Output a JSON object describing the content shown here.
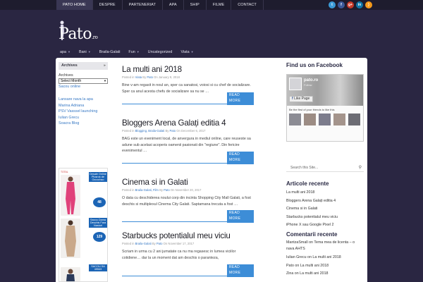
{
  "topnav": [
    "PATO HOME",
    "DESPRE",
    "PARTENERIAT",
    "APA",
    "SHIP",
    "FILME",
    "CONTACT"
  ],
  "social": [
    {
      "icon": "twitter-icon",
      "glyph": "t",
      "color": "#3b9bd7"
    },
    {
      "icon": "facebook-icon",
      "glyph": "f",
      "color": "#3b5998"
    },
    {
      "icon": "google-plus-icon",
      "glyph": "g+",
      "color": "#c53928"
    },
    {
      "icon": "linkedin-icon",
      "glyph": "in",
      "color": "#0e76a8"
    },
    {
      "icon": "rss-icon",
      "glyph": ")",
      "color": "#f59a1b"
    }
  ],
  "logo": {
    "main": "Pato",
    "suffix": ".ro"
  },
  "catnav": [
    {
      "label": "apa",
      "arrow": true
    },
    {
      "label": "Bani",
      "arrow": true
    },
    {
      "label": "Braila-Galati",
      "arrow": false
    },
    {
      "label": "Fun",
      "arrow": true
    },
    {
      "label": "Uncategorized",
      "arrow": false
    },
    {
      "label": "Viata",
      "arrow": true
    }
  ],
  "left": {
    "archives_title": "Archives",
    "archives_label": "Archives",
    "select_value": "Select Month",
    "link1": "Sacou online",
    "links": [
      "Lansare nava la apa",
      "Marina Adriana",
      "PSV Vasssel launching",
      "Iulian Grecu",
      "Soacra Blog"
    ]
  },
  "ad": {
    "rows": [
      {
        "top_label": "TOTAL",
        "blue": "Desale Online Plusrok de Occochao",
        "price": "48"
      },
      {
        "top_label": "",
        "blue": "Sacou Dama Deschis Fara Nasturi",
        "price": "129"
      },
      {
        "top_label": "",
        "blue": "SACOU SA 49543",
        "price": ""
      }
    ]
  },
  "posts": [
    {
      "title": "La multi ani 2018",
      "meta_pre": "Posted in ",
      "cats": "Viata",
      "by": " By ",
      "author": "Pato",
      "on": " On January 9, 2018",
      "excerpt": "Bine v-am regasit in noul an, sper ca sanatosi, voiosi si cu chef de socializare. Sper ca anul acesta chefu de socializare sa nu se …",
      "readmore": "READ MORE"
    },
    {
      "title": "Bloggers Arena Galați editia 4",
      "meta_pre": "Posted in ",
      "cats": "Blogging, Braila-Galati",
      "by": " By ",
      "author": "Pato",
      "on": " On December 6, 2017",
      "excerpt": "BAG este un eveniment local, de anvergura in mediul online, care reuseste sa adune sub acelasi acoperis oamenii pasionati din \"regiune\". Din fericire evenimentul …",
      "readmore": "READ MORE"
    },
    {
      "title": "Cinema si in Galati",
      "meta_pre": "Posted in ",
      "cats": "Braila-Galati, Film",
      "by": " By ",
      "author": "Pato",
      "on": " On November 20, 2017",
      "excerpt": "O data cu deschiderea noului corp din incinta Shopping City Mall Galati, a fost deschis si multiplexul Cinema City Galati. Saptamana trecuta a fost …",
      "readmore": "READ MORE"
    },
    {
      "title": "Starbucks potentialul meu viciu",
      "meta_pre": "Posted in ",
      "cats": "Braila-Galati",
      "by": " By ",
      "author": "Pato",
      "on": " On November 17, 2017",
      "excerpt": "Scriam in urma cu 2 ani jumatate ca nu ma regasesc in lumea viciilor cotidiene… dar la un moment dat am deschis o paranteza,",
      "readmore": "READ MORE"
    }
  ],
  "right": {
    "fb_title": "Find us on Facebook",
    "fb_name": "pato.ro",
    "fb_follow": "Follow",
    "fb_like": "Like Page",
    "fb_first": "Be the first of your friends to like this",
    "fb_faces": [
      "",
      "",
      "",
      "",
      ""
    ],
    "search_placeholder": "Search this Site...",
    "recent_title": "Articole recente",
    "recent": [
      "La multi ani 2018",
      "Bloggers Arena Galați editia 4",
      "Cinema si in Galati",
      "Starbucks potentialul meu viciu",
      "iPhone X sau Google Pixel 2"
    ],
    "comments_title": "Comentarii recente",
    "comments": [
      {
        "who": "MantzaSmall",
        "txt": " on Tema mea de licenta – o nava AHTS"
      },
      {
        "who": "Iulian Grecu",
        "txt": " on La multi ani 2018"
      },
      {
        "who": "Pato",
        "txt": " on La multi ani 2018"
      },
      {
        "who": "Zina",
        "txt": " on La multi ani 2018"
      }
    ]
  }
}
